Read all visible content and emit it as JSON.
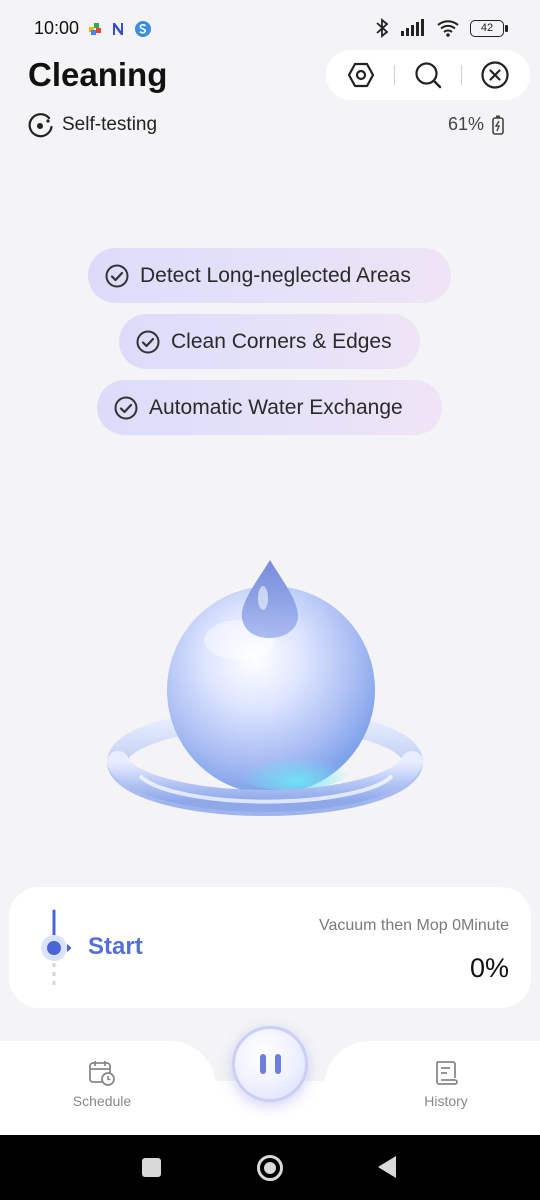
{
  "status_bar": {
    "time": "10:00",
    "battery_level": "42",
    "left_icons": [
      "app-icon-colorful",
      "app-icon-n",
      "app-icon-s"
    ],
    "right_icons": [
      "bluetooth-icon",
      "signal-icon",
      "wifi-icon",
      "battery-icon"
    ]
  },
  "header": {
    "title": "Cleaning",
    "actions": [
      "settings-hexagon-icon",
      "search-icon",
      "close-icon"
    ]
  },
  "device": {
    "status_label": "Self-testing",
    "battery": "61%"
  },
  "features": [
    {
      "label": "Detect Long-neglected Areas"
    },
    {
      "label": "Clean Corners & Edges"
    },
    {
      "label": "Automatic Water Exchange"
    }
  ],
  "progress": {
    "start_label": "Start",
    "mode": "Vacuum then Mop 0Minute",
    "percent": "0%"
  },
  "bottom_nav": {
    "schedule_label": "Schedule",
    "history_label": "History",
    "center_action": "pause-icon"
  },
  "colors": {
    "accent": "#5470d8",
    "background": "#f4f4f6",
    "pill_gradient_start": "#dcdcfa",
    "pill_gradient_end": "#efe4f6"
  }
}
